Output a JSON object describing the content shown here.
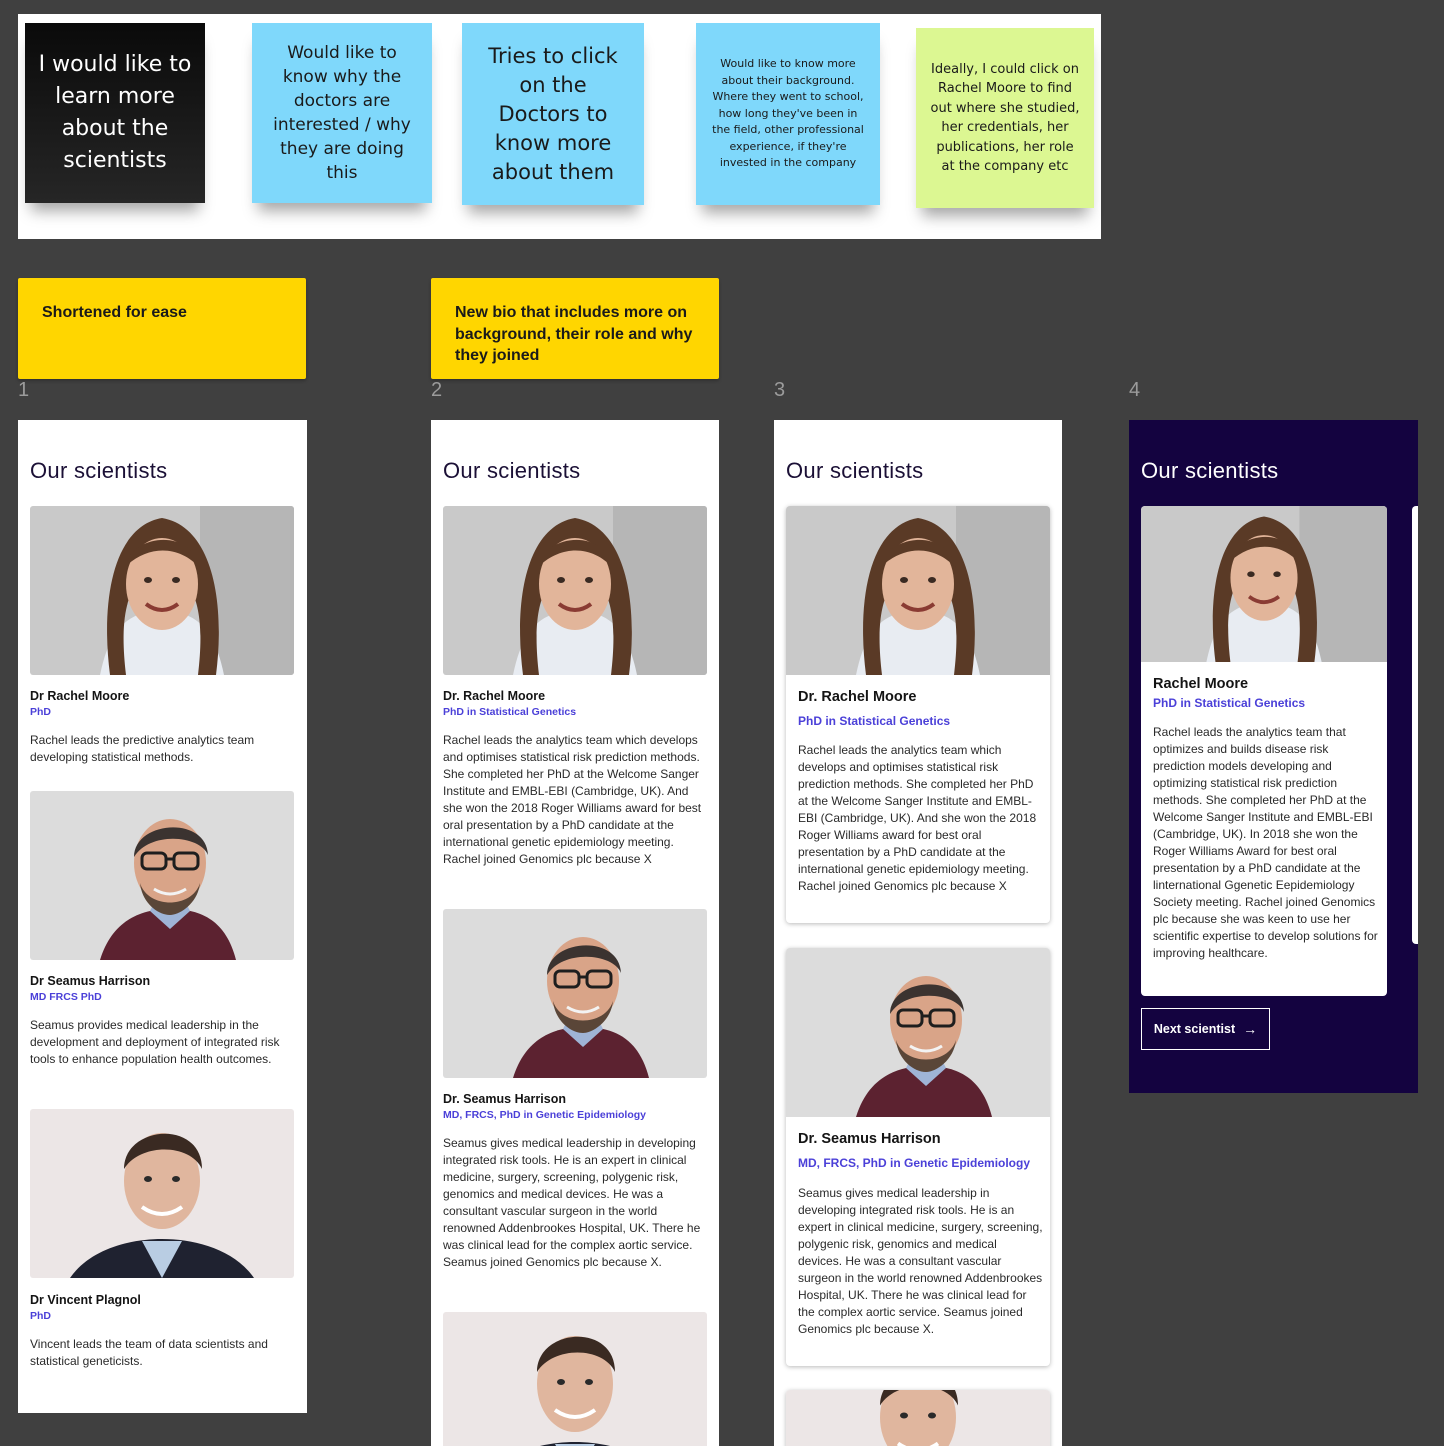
{
  "stickies": [
    "I would like to learn more about the scientists",
    "Would like to know why the doctors are interested / why they are doing this",
    "Tries to click on the Doctors to know more about them",
    "Would like to know more about their background. Where they went to school, how long they've been in the field, other professional experience, if they're invested in the company",
    "Ideally, I could click on Rachel Moore to find out where she studied, her credentials, her publications, her role at the company etc"
  ],
  "notes": {
    "note1": "Shortened for ease",
    "note2": "New bio that includes more on background, their role and why they joined"
  },
  "frame_numbers": [
    "1",
    "2",
    "3",
    "4"
  ],
  "section_title": "Our scientists",
  "frame1": {
    "scientists": [
      {
        "name": "Dr Rachel Moore",
        "cred": "PhD",
        "bio": "Rachel leads the predictive analytics team developing statistical methods."
      },
      {
        "name": "Dr Seamus Harrison",
        "cred": "MD FRCS PhD",
        "bio": "Seamus provides medical leadership in the development and deployment of integrated risk tools to enhance population health outcomes."
      },
      {
        "name": "Dr Vincent Plagnol",
        "cred": "PhD",
        "bio": "Vincent leads the team of data scientists and statistical geneticists."
      }
    ]
  },
  "frame2": {
    "scientists": [
      {
        "name": "Dr. Rachel Moore",
        "cred": "PhD in Statistical Genetics",
        "bio": "Rachel leads the analytics team which develops and optimises statistical risk prediction methods. She completed her PhD at the Welcome Sanger Institute and EMBL-EBI (Cambridge, UK). And she won the 2018 Roger Williams award for best oral presentation by a PhD candidate at the international genetic epidemiology meeting. Rachel joined Genomics plc because X"
      },
      {
        "name": "Dr. Seamus Harrison",
        "cred": "MD, FRCS, PhD in Genetic Epidemiology",
        "bio": "Seamus gives medical leadership in developing integrated risk tools. He is an expert in clinical medicine, surgery, screening, polygenic risk, genomics and medical devices. He was a consultant vascular surgeon in the world renowned Addenbrookes Hospital, UK. There he was clinical lead for the complex aortic service. Seamus joined Genomics plc because X."
      }
    ]
  },
  "frame3": {
    "scientists": [
      {
        "name": "Dr. Rachel Moore",
        "cred": "PhD in Statistical Genetics",
        "bio": "Rachel leads the analytics team which develops and optimises statistical risk prediction methods. She completed her PhD at the Welcome Sanger Institute and EMBL-EBI (Cambridge, UK). And she won the 2018 Roger Williams award for best oral presentation by a PhD candidate at the international genetic epidemiology meeting. Rachel joined Genomics plc because X"
      },
      {
        "name": "Dr. Seamus Harrison",
        "cred": "MD, FRCS, PhD in Genetic Epidemiology",
        "bio": "Seamus gives medical leadership in developing integrated risk tools. He is an expert in clinical medicine, surgery, screening, polygenic risk, genomics and medical devices. He was a consultant vascular surgeon in the world renowned Addenbrookes Hospital, UK. There he was clinical lead for the complex aortic service. Seamus joined Genomics plc because X."
      }
    ]
  },
  "frame4": {
    "scientist": {
      "name": "Rachel Moore",
      "cred": "PhD in Statistical Genetics",
      "bio": "Rachel leads the analytics team that optimizes and builds disease risk prediction models developing and optimizing statistical risk prediction methods. She completed her PhD at the Welcome Sanger Institute and EMBL-EBI (Cambridge, UK). In 2018 she won the Roger Williams Award for best oral presentation by a PhD candidate at the linternational Ggenetic Eepidemiology Society meeting. Rachel joined Genomics plc because she was keen to use her scientific expertise to develop solutions for improving healthcare."
    },
    "next_label": "Next scientist",
    "next_icon": "arrow-right-icon"
  },
  "colors": {
    "background": "#404040",
    "accent": "#4b40d8",
    "dark_frame": "#140340",
    "note_yellow": "#ffd600",
    "sticky_blue": "#7fd8fb",
    "sticky_green": "#dcf792"
  }
}
